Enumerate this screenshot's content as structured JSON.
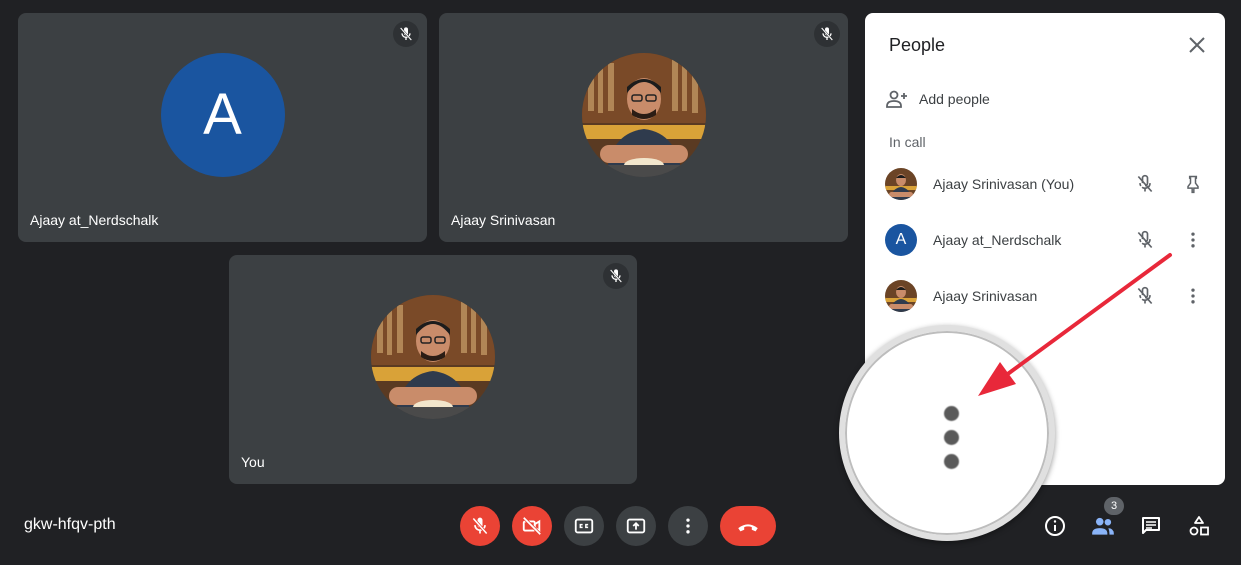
{
  "tiles": [
    {
      "name": "Ajaay at_Nerdschalk",
      "avatar_letter": "A"
    },
    {
      "name": "Ajaay Srinivasan"
    },
    {
      "name": "You"
    }
  ],
  "panel": {
    "title": "People",
    "add_people_label": "Add people",
    "section_label": "In call",
    "participants": [
      {
        "name": "Ajaay Srinivasan (You)",
        "action_icon": "pin-icon"
      },
      {
        "name": "Ajaay at_Nerdschalk",
        "avatar_letter": "A",
        "action_icon": "more-vert-icon"
      },
      {
        "name": "Ajaay Srinivasan",
        "action_icon": "more-vert-icon"
      }
    ]
  },
  "meeting": {
    "code": "gkw-hfqv-pth"
  },
  "toolbar": {
    "people_count": "3"
  },
  "colors": {
    "background": "#202124",
    "tile": "#3c4043",
    "danger": "#ea4335",
    "accent": "#8ab4f8",
    "avatar_blue": "#1a55a0",
    "annotation_arrow": "#e8283a"
  }
}
